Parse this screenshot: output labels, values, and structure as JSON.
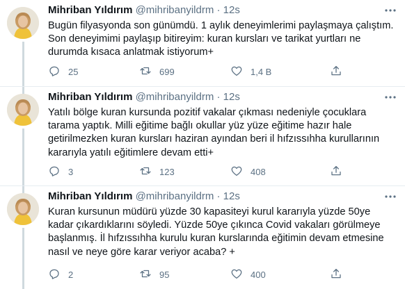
{
  "tweets": [
    {
      "name": "Mihriban Yıldırım",
      "handle": "@mihribanyildrm",
      "dot": "·",
      "time": "12s",
      "text": "Bugün filyasyonda son günümdü. 1 aylık deneyimlerimi paylaşmaya çalıştım. Son deneyimimi paylaşıp bitireyim: kuran kursları ve tarikat yurtları ne durumda kısaca anlatmak istiyorum+",
      "replies": "25",
      "retweets": "699",
      "likes": "1,4 B"
    },
    {
      "name": "Mihriban Yıldırım",
      "handle": "@mihribanyildrm",
      "dot": "·",
      "time": "12s",
      "text": "Yatılı bölge kuran kursunda pozitif vakalar çıkması nedeniyle çocuklara tarama yaptık. Milli eğitime bağlı okullar yüz yüze eğitime hazır hale getirilmezken kuran kursları haziran ayından beri il hıfzıssıhha kurullarının kararıyla yatılı eğitimlere devam etti+",
      "replies": "3",
      "retweets": "123",
      "likes": "408"
    },
    {
      "name": "Mihriban Yıldırım",
      "handle": "@mihribanyildrm",
      "dot": "·",
      "time": "12s",
      "text": "Kuran kursunun müdürü yüzde 30 kapasiteyi kurul kararıyla yüzde 50ye kadar çıkardıklarını söyledi. Yüzde 50ye çıkınca Covid vakaları görülmeye başlanmış. İl hıfzıssıhha kurulu kuran kurslarında eğitimin devam etmesine nasıl ve neye göre karar veriyor acaba? +",
      "replies": "2",
      "retweets": "95",
      "likes": "400"
    }
  ],
  "icons": {
    "reply": "reply-icon",
    "retweet": "retweet-icon",
    "like": "heart-icon",
    "share": "share-icon",
    "more": "more-icon"
  },
  "colors": {
    "muted": "#5b7083",
    "separator": "#e6ecf0",
    "thread_line": "#cfd9de"
  }
}
